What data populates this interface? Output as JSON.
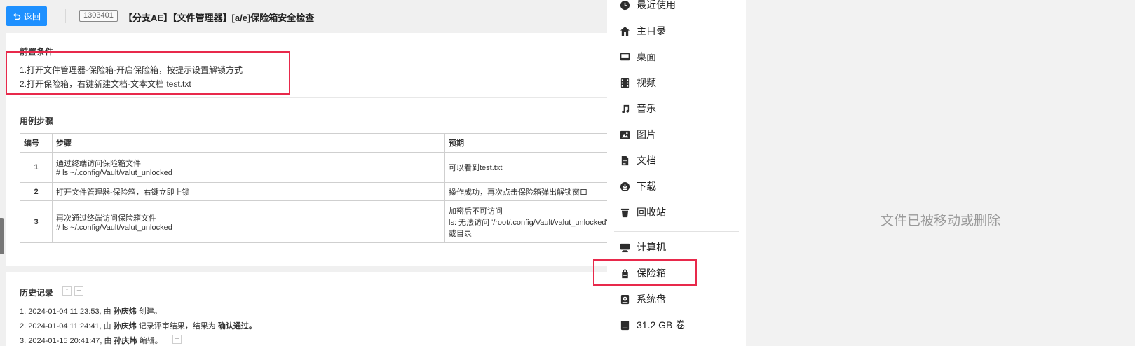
{
  "header": {
    "back_label": "返回",
    "case_id": "1303401",
    "case_title": "【分支AE】【文件管理器】[a/e]保险箱安全检查"
  },
  "preconditions": {
    "title": "前置条件",
    "lines": [
      "1.打开文件管理器-保险箱-开启保险箱，按提示设置解锁方式",
      "2.打开保险箱，右键新建文档-文本文档 test.txt"
    ]
  },
  "steps": {
    "title": "用例步骤",
    "columns": [
      "编号",
      "步骤",
      "预期"
    ],
    "rows": [
      {
        "num": "1",
        "step": [
          "通过终端访问保险箱文件",
          "# ls ~/.config/Vault/valut_unlocked"
        ],
        "expected": [
          "可以看到test.txt"
        ]
      },
      {
        "num": "2",
        "step": [
          "打开文件管理器-保险箱，右键立即上锁"
        ],
        "expected": [
          "操作成功，再次点击保险箱弹出解锁窗口"
        ]
      },
      {
        "num": "3",
        "step": [
          "再次通过终端访问保险箱文件",
          "# ls ~/.config/Vault/valut_unlocked"
        ],
        "expected": [
          "加密后不可访问",
          "ls: 无法访问 '/root/.config/Vault/valut_unlocked': 没有那个文件",
          "或目录"
        ]
      }
    ]
  },
  "history": {
    "title": "历史记录",
    "entries": [
      {
        "prefix": "1. 2024-01-04 11:23:53, 由 ",
        "user": "孙庆炜",
        "action": " 创建。",
        "extra": ""
      },
      {
        "prefix": "2. 2024-01-04 11:24:41, 由 ",
        "user": "孙庆炜",
        "action": " 记录评审结果，结果为 ",
        "extra": "确认通过。"
      },
      {
        "prefix": "3. 2024-01-15 20:41:47, 由 ",
        "user": "孙庆炜",
        "action": " 编辑。",
        "extra": ""
      }
    ]
  },
  "sidebar": {
    "items": [
      {
        "label": "最近使用",
        "icon": "clock-icon"
      },
      {
        "label": "主目录",
        "icon": "home-icon"
      },
      {
        "label": "桌面",
        "icon": "desktop-icon"
      },
      {
        "label": "视频",
        "icon": "film-icon"
      },
      {
        "label": "音乐",
        "icon": "music-icon"
      },
      {
        "label": "图片",
        "icon": "image-icon"
      },
      {
        "label": "文档",
        "icon": "document-icon"
      },
      {
        "label": "下载",
        "icon": "download-icon"
      },
      {
        "label": "回收站",
        "icon": "trash-icon"
      },
      {
        "label": "计算机",
        "icon": "computer-icon"
      },
      {
        "label": "保险箱",
        "icon": "vault-icon"
      },
      {
        "label": "系统盘",
        "icon": "system-disk-icon"
      },
      {
        "label": "31.2 GB 卷",
        "icon": "disk-icon"
      }
    ]
  },
  "content": {
    "empty_message": "文件已被移动或删除"
  },
  "colors": {
    "accent": "#1e90ff",
    "highlight": "#e8294b"
  }
}
